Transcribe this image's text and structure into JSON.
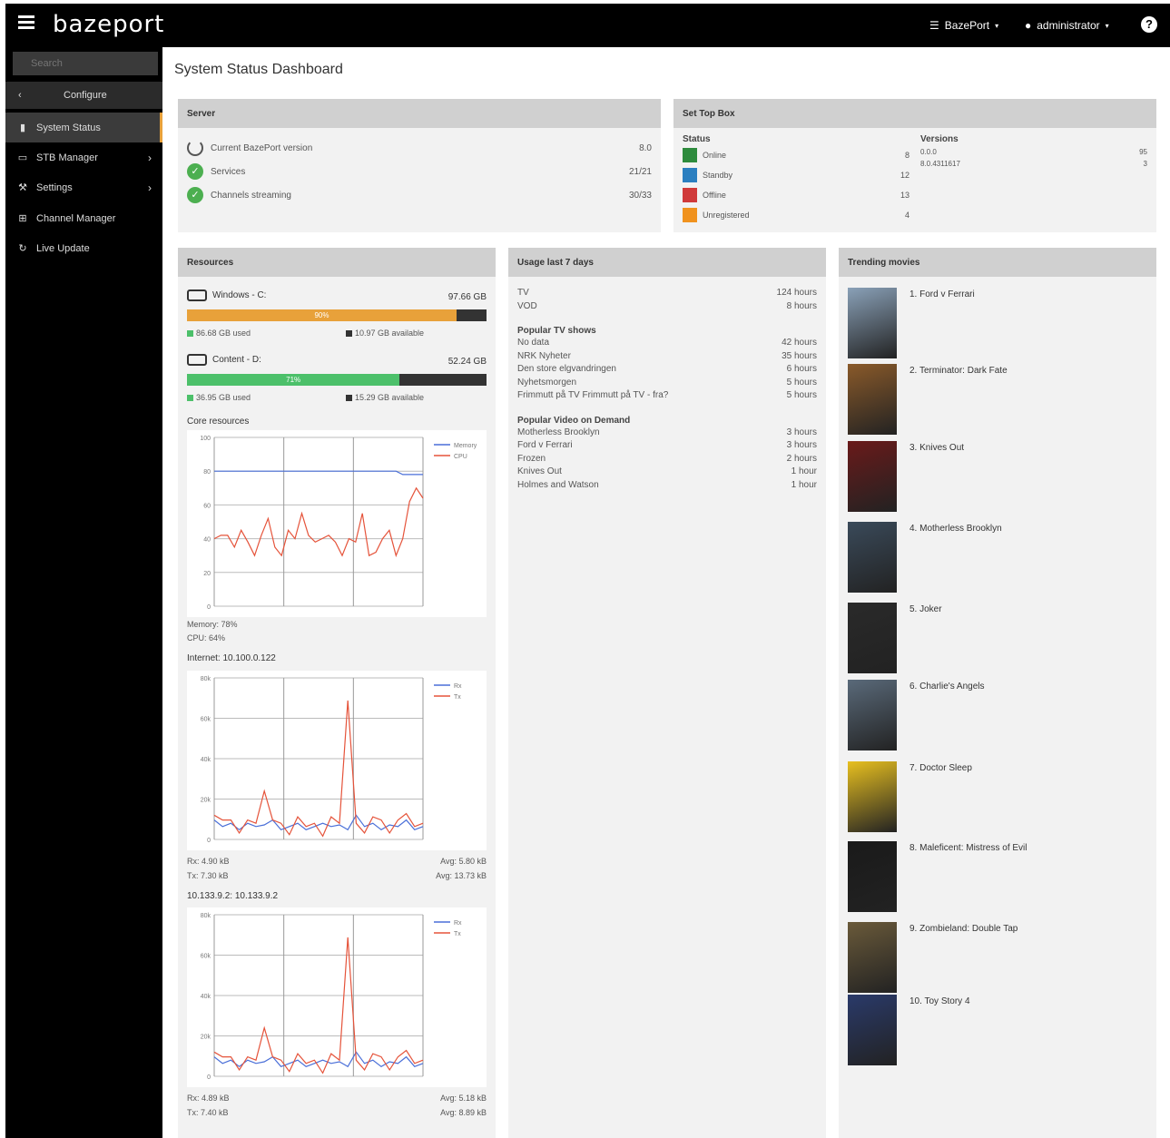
{
  "header": {
    "logo": "bazeport",
    "org": "BazePort",
    "user": "administrator"
  },
  "sidebar": {
    "search_placeholder": "Search",
    "configure": "Configure",
    "items": [
      {
        "label": "System Status",
        "icon": "document-icon"
      },
      {
        "label": "STB Manager",
        "icon": "monitor-icon"
      },
      {
        "label": "Settings",
        "icon": "wrench-icon"
      },
      {
        "label": "Channel Manager",
        "icon": "grid-icon"
      },
      {
        "label": "Live Update",
        "icon": "refresh-icon"
      }
    ]
  },
  "page": {
    "title": "System Status Dashboard"
  },
  "server": {
    "title": "Server",
    "rows": [
      {
        "label": "Current BazePort version",
        "value": "8.0"
      },
      {
        "label": "Services",
        "value": "21/21"
      },
      {
        "label": "Channels streaming",
        "value": "30/33"
      }
    ]
  },
  "stb": {
    "title": "Set Top Box",
    "status_header": "Status",
    "versions_header": "Versions",
    "statuses": [
      {
        "label": "Online",
        "value": "8",
        "color": "#2e8b3d"
      },
      {
        "label": "Standby",
        "value": "12",
        "color": "#2b7fc0"
      },
      {
        "label": "Offline",
        "value": "13",
        "color": "#d03a3a"
      },
      {
        "label": "Unregistered",
        "value": "4",
        "color": "#f0921e"
      }
    ],
    "versions": [
      {
        "label": "0.0.0",
        "value": "95"
      },
      {
        "label": "8.0.4311617",
        "value": "3"
      }
    ]
  },
  "resources": {
    "title": "Resources",
    "disks": [
      {
        "name": "Windows - C:",
        "size": "97.66 GB",
        "percent": 90,
        "percent_label": "90%",
        "used": "86.68 GB used",
        "available": "10.97 GB available",
        "color": "#e8a13a"
      },
      {
        "name": "Content - D:",
        "size": "52.24 GB",
        "percent": 71,
        "percent_label": "71%",
        "used": "36.95 GB used",
        "available": "15.29 GB available",
        "color": "#4cc06a"
      }
    ],
    "core_title": "Core resources",
    "memory": "Memory: 78%",
    "cpu": "CPU: 64%",
    "internet_title": "Internet: 10.100.0.122",
    "net1_rx": "Rx: 4.90 kB",
    "net1_tx": "Tx: 7.30 kB",
    "net1_avg_rx": "Avg: 5.80 kB",
    "net1_avg_tx": "Avg: 13.73 kB",
    "net2_title": "10.133.9.2: 10.133.9.2",
    "net2_rx": "Rx: 4.89 kB",
    "net2_tx": "Tx: 7.40 kB",
    "net2_avg_rx": "Avg: 5.18 kB",
    "net2_avg_tx": "Avg: 8.89 kB"
  },
  "usage": {
    "title": "Usage last 7 days",
    "totals": [
      {
        "label": "TV",
        "value": "124 hours"
      },
      {
        "label": "VOD",
        "value": "8 hours"
      }
    ],
    "tv_header": "Popular TV shows",
    "tv": [
      {
        "label": "No data",
        "value": "42 hours"
      },
      {
        "label": "NRK Nyheter",
        "value": "35 hours"
      },
      {
        "label": "Den store elgvandringen",
        "value": "6 hours"
      },
      {
        "label": "Nyhetsmorgen",
        "value": "5 hours"
      },
      {
        "label": "Frimmutt på TV Frimmutt på TV - fra?",
        "value": "5 hours"
      }
    ],
    "vod_header": "Popular Video on Demand",
    "vod": [
      {
        "label": "Motherless Brooklyn",
        "value": "3 hours"
      },
      {
        "label": "Ford v Ferrari",
        "value": "3 hours"
      },
      {
        "label": "Frozen",
        "value": "2 hours"
      },
      {
        "label": "Knives Out",
        "value": "1 hour"
      },
      {
        "label": "Holmes and Watson",
        "value": "1 hour"
      }
    ]
  },
  "movies": {
    "title": "Trending movies",
    "items": [
      {
        "label": "1. Ford v Ferrari",
        "color": "#8aa1b8"
      },
      {
        "label": "2. Terminator: Dark Fate",
        "color": "#8a5a2a"
      },
      {
        "label": "3. Knives Out",
        "color": "#6a1a1a"
      },
      {
        "label": "4. Motherless Brooklyn",
        "color": "#3a4a5a"
      },
      {
        "label": "5. Joker",
        "color": "#2a2a2a"
      },
      {
        "label": "6. Charlie's Angels",
        "color": "#5a6a7a"
      },
      {
        "label": "7. Doctor Sleep",
        "color": "#e8c020"
      },
      {
        "label": "8. Maleficent: Mistress of Evil",
        "color": "#1a1a1a"
      },
      {
        "label": "9. Zombieland: Double Tap",
        "color": "#6a5a3a"
      },
      {
        "label": "10. Toy Story 4",
        "color": "#2a3a6a"
      }
    ]
  },
  "chart_data": [
    {
      "type": "line",
      "title": "Core resources",
      "ylim": [
        0,
        100
      ],
      "yticks": [
        "0",
        "20",
        "40",
        "60",
        "80",
        "100"
      ],
      "series": [
        {
          "name": "Memory",
          "color": "#4a6fd8",
          "values": [
            80,
            80,
            80,
            80,
            80,
            80,
            80,
            80,
            80,
            80,
            80,
            80,
            80,
            80,
            80,
            80,
            80,
            80,
            80,
            80,
            80,
            80,
            80,
            80,
            80,
            80,
            80,
            80,
            78,
            78,
            78,
            78
          ]
        },
        {
          "name": "CPU",
          "color": "#e5533a",
          "values": [
            40,
            42,
            42,
            35,
            45,
            38,
            30,
            42,
            52,
            35,
            30,
            45,
            40,
            55,
            42,
            38,
            40,
            42,
            38,
            30,
            40,
            38,
            55,
            30,
            32,
            40,
            45,
            30,
            40,
            62,
            70,
            64
          ]
        }
      ]
    },
    {
      "type": "line",
      "title": "Internet: 10.100.0.122",
      "ylim": [
        0,
        100
      ],
      "yticks": [
        "0",
        "20k",
        "40k",
        "60k",
        "80k"
      ],
      "series": [
        {
          "name": "Rx",
          "color": "#4a6fd8",
          "values": [
            12,
            8,
            10,
            6,
            10,
            8,
            9,
            12,
            6,
            8,
            10,
            6,
            8,
            10,
            8,
            9,
            6,
            15,
            8,
            10,
            6,
            9,
            8,
            12,
            6,
            8
          ]
        },
        {
          "name": "Tx",
          "color": "#e5533a",
          "values": [
            15,
            12,
            12,
            4,
            12,
            10,
            30,
            12,
            10,
            3,
            14,
            8,
            10,
            2,
            14,
            10,
            86,
            10,
            4,
            14,
            12,
            4,
            12,
            16,
            8,
            10
          ]
        }
      ]
    },
    {
      "type": "line",
      "title": "10.133.9.2: 10.133.9.2",
      "ylim": [
        0,
        100
      ],
      "yticks": [
        "0",
        "20k",
        "40k",
        "60k",
        "80k"
      ],
      "series": [
        {
          "name": "Rx",
          "color": "#4a6fd8",
          "values": [
            12,
            8,
            10,
            6,
            10,
            8,
            9,
            12,
            6,
            8,
            10,
            6,
            8,
            10,
            8,
            9,
            6,
            15,
            8,
            10,
            6,
            9,
            8,
            12,
            6,
            8
          ]
        },
        {
          "name": "Tx",
          "color": "#e5533a",
          "values": [
            15,
            12,
            12,
            4,
            12,
            10,
            30,
            12,
            10,
            3,
            14,
            8,
            10,
            2,
            14,
            10,
            86,
            10,
            4,
            14,
            12,
            4,
            12,
            16,
            8,
            10
          ]
        }
      ]
    }
  ]
}
